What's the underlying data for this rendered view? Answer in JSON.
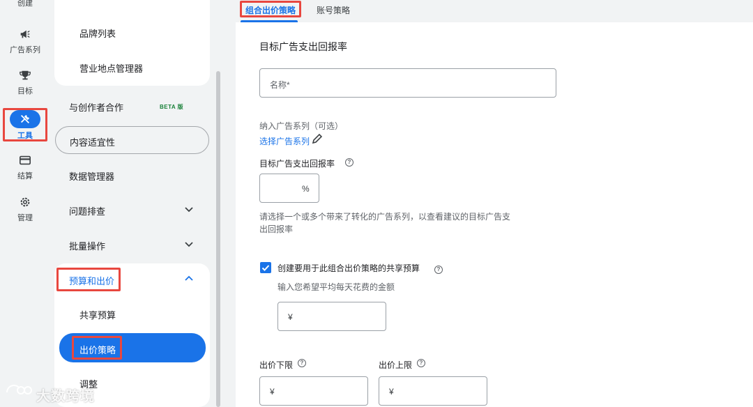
{
  "rail": {
    "items": [
      {
        "label": "创建",
        "icon": "plus-icon"
      },
      {
        "label": "广告系列",
        "icon": "megaphone-icon"
      },
      {
        "label": "目标",
        "icon": "trophy-icon"
      },
      {
        "label": "工具",
        "icon": "tools-icon"
      },
      {
        "label": "结算",
        "icon": "credit-card-icon"
      },
      {
        "label": "管理",
        "icon": "gear-icon"
      }
    ]
  },
  "nav": {
    "top_card_items": [
      "品牌列表",
      "营业地点管理器"
    ],
    "creator_label": "与创作者合作",
    "beta_label": "BETA 版",
    "content_suitability": "内容适宜性",
    "data_manager": "数据管理器",
    "troubleshooting": "问题排查",
    "bulk_actions": "批量操作",
    "budgets_bidding": "预算和出价",
    "sub_items": [
      "共享预算",
      "出价策略",
      "调整"
    ]
  },
  "tabs": [
    "组合出价策略",
    "账号策略"
  ],
  "form": {
    "heading": "目标广告支出回报率",
    "name_placeholder": "名称*",
    "include_campaigns_label": "纳入广告系列（可选）",
    "select_campaigns_link": "选择广告系列",
    "target_roas_label": "目标广告支出回报率",
    "percent_suffix": "%",
    "hint": "请选择一个或多个带来了转化的广告系列，以查看建议的目标广告支出回报率",
    "shared_budget_label": "创建要用于此组合出价策略的共享预算",
    "shared_budget_checked": true,
    "avg_spend_hint": "输入您希望平均每天花费的金额",
    "currency_symbol": "¥",
    "bid_floor_label": "出价下限",
    "bid_ceiling_label": "出价上限",
    "help_glyph": "?"
  },
  "watermark": "大数跨境",
  "colors": {
    "accent": "#1a73e8",
    "highlight_box": "#e8473f",
    "beta": "#188038"
  }
}
